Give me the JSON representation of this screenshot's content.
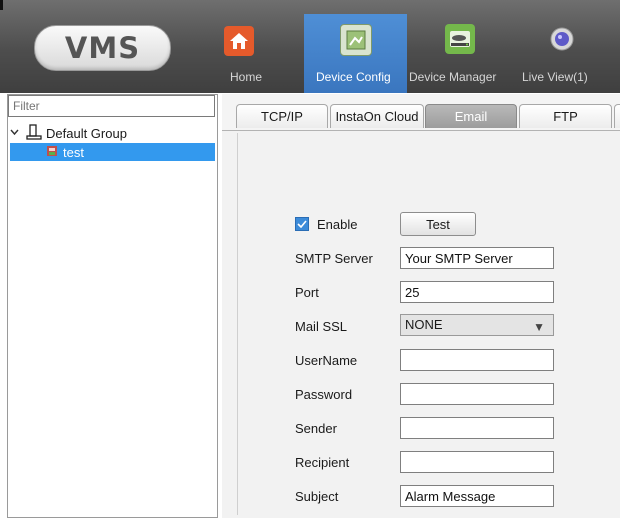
{
  "app": {
    "logo_text": "VMS"
  },
  "nav": [
    {
      "label": "Home",
      "icon": "home-icon",
      "color": "#e55a2b"
    },
    {
      "label": "Device Config",
      "icon": "device-config-icon",
      "color": "#8fb86a"
    },
    {
      "label": "Device Manager",
      "icon": "device-manager-icon",
      "color": "#74b84b"
    },
    {
      "label": "Live View(1)",
      "icon": "live-view-icon",
      "color": "#5e5ac8"
    }
  ],
  "sidebar": {
    "filter_placeholder": "Filter",
    "group": {
      "label": "Default Group",
      "expanded_glyph": "✓"
    },
    "items": [
      {
        "label": "test"
      }
    ]
  },
  "tabs": [
    {
      "label": "TCP/IP"
    },
    {
      "label": "InstaOn Cloud"
    },
    {
      "label": "Email",
      "active": true
    },
    {
      "label": "FTP"
    }
  ],
  "email_form": {
    "enable_label": "Enable",
    "enable_checked": true,
    "test_button": "Test",
    "fields": [
      {
        "label": "SMTP Server",
        "value": "Your SMTP Server"
      },
      {
        "label": "Port",
        "value": "25"
      },
      {
        "label": "Mail SSL",
        "value": "NONE"
      },
      {
        "label": "UserName",
        "value": ""
      },
      {
        "label": "Password",
        "value": ""
      },
      {
        "label": "Sender",
        "value": ""
      },
      {
        "label": "Recipient",
        "value": ""
      },
      {
        "label": "Subject",
        "value": "Alarm Message"
      }
    ]
  },
  "colors": {
    "active_nav": "#3a76bf",
    "selected_item": "#3399ee",
    "checkbox": "#3c8bd9"
  }
}
